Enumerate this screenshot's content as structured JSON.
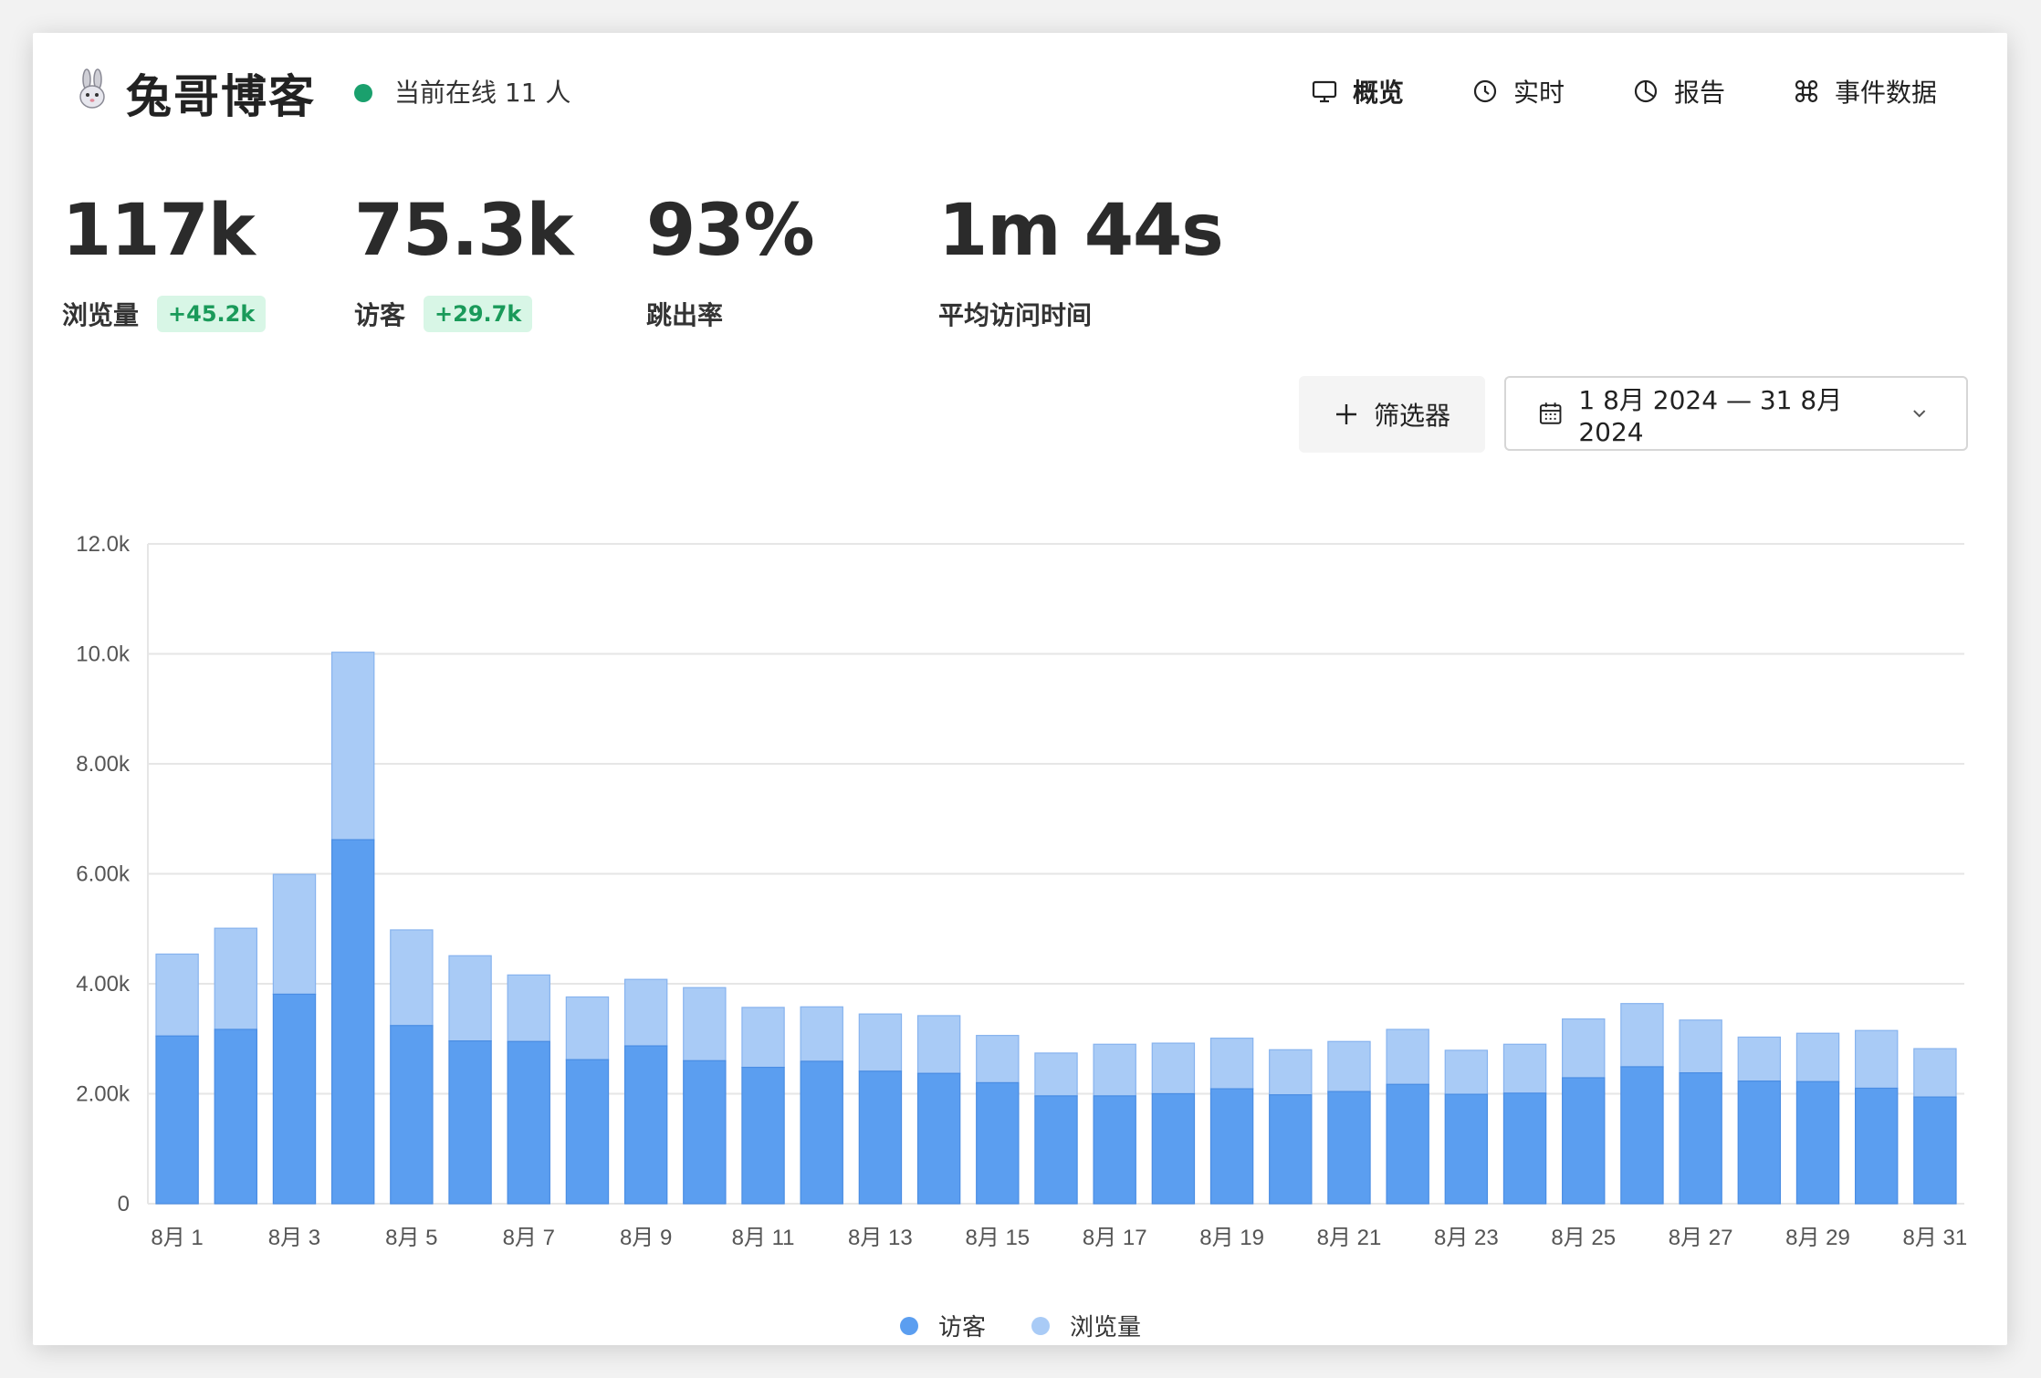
{
  "header": {
    "logo_icon": "rabbit-icon",
    "site_title": "兔哥博客",
    "online_text": "当前在线 11 人",
    "online_color": "#1aa06d"
  },
  "nav": {
    "overview": "概览",
    "realtime": "实时",
    "reports": "报告",
    "events": "事件数据"
  },
  "metrics": {
    "pageviews": {
      "value": "117k",
      "label": "浏览量",
      "change": "+45.2k"
    },
    "visitors": {
      "value": "75.3k",
      "label": "访客",
      "change": "+29.7k"
    },
    "bounce": {
      "value": "93%",
      "label": "跳出率"
    },
    "avg_time": {
      "value": "1m 44s",
      "label": "平均访问时间"
    }
  },
  "controls": {
    "filter_label": "筛选器",
    "date_range": "1 8月 2024 — 31 8月 2024"
  },
  "colors": {
    "visitors": "#5b9ef0",
    "pageviews": "#a9cbf6",
    "visitors_border": "#4a8de3",
    "pageviews_border": "#87b3ee",
    "badge_bg": "#d8f6e6",
    "badge_text": "#1a9a5a"
  },
  "chart_data": {
    "type": "bar",
    "stacked": true,
    "categories": [
      "8月 1",
      "8月 2",
      "8月 3",
      "8月 4",
      "8月 5",
      "8月 6",
      "8月 7",
      "8月 8",
      "8月 9",
      "8月 10",
      "8月 11",
      "8月 12",
      "8月 13",
      "8月 14",
      "8月 15",
      "8月 16",
      "8月 17",
      "8月 18",
      "8月 19",
      "8月 20",
      "8月 21",
      "8月 22",
      "8月 23",
      "8月 24",
      "8月 25",
      "8月 26",
      "8月 27",
      "8月 28",
      "8月 29",
      "8月 30",
      "8月 31"
    ],
    "tick_labels": [
      "8月 1",
      "8月 3",
      "8月 5",
      "8月 7",
      "8月 9",
      "8月 11",
      "8月 13",
      "8月 15",
      "8月 17",
      "8月 19",
      "8月 21",
      "8月 23",
      "8月 25",
      "8月 27",
      "8月 29",
      "8月 31"
    ],
    "y_ticks": [
      "0",
      "2.00k",
      "4.00k",
      "6.00k",
      "8.00k",
      "10.0k",
      "12.0k"
    ],
    "ylim": [
      0,
      12000
    ],
    "series": [
      {
        "name": "访客",
        "values": [
          3050,
          3170,
          3810,
          6620,
          3240,
          2960,
          2950,
          2620,
          2870,
          2600,
          2480,
          2590,
          2410,
          2370,
          2200,
          1960,
          1960,
          2000,
          2090,
          1980,
          2040,
          2170,
          1990,
          2010,
          2290,
          2490,
          2380,
          2230,
          2220,
          2100,
          1940
        ]
      },
      {
        "name": "浏览量",
        "values": [
          4540,
          5010,
          5990,
          10030,
          4980,
          4510,
          4160,
          3760,
          4080,
          3930,
          3570,
          3580,
          3450,
          3420,
          3060,
          2740,
          2900,
          2920,
          3010,
          2800,
          2950,
          3170,
          2790,
          2900,
          3360,
          3640,
          3340,
          3030,
          3100,
          3150,
          2820
        ]
      }
    ],
    "grid": true,
    "legend": "bottom-center"
  }
}
